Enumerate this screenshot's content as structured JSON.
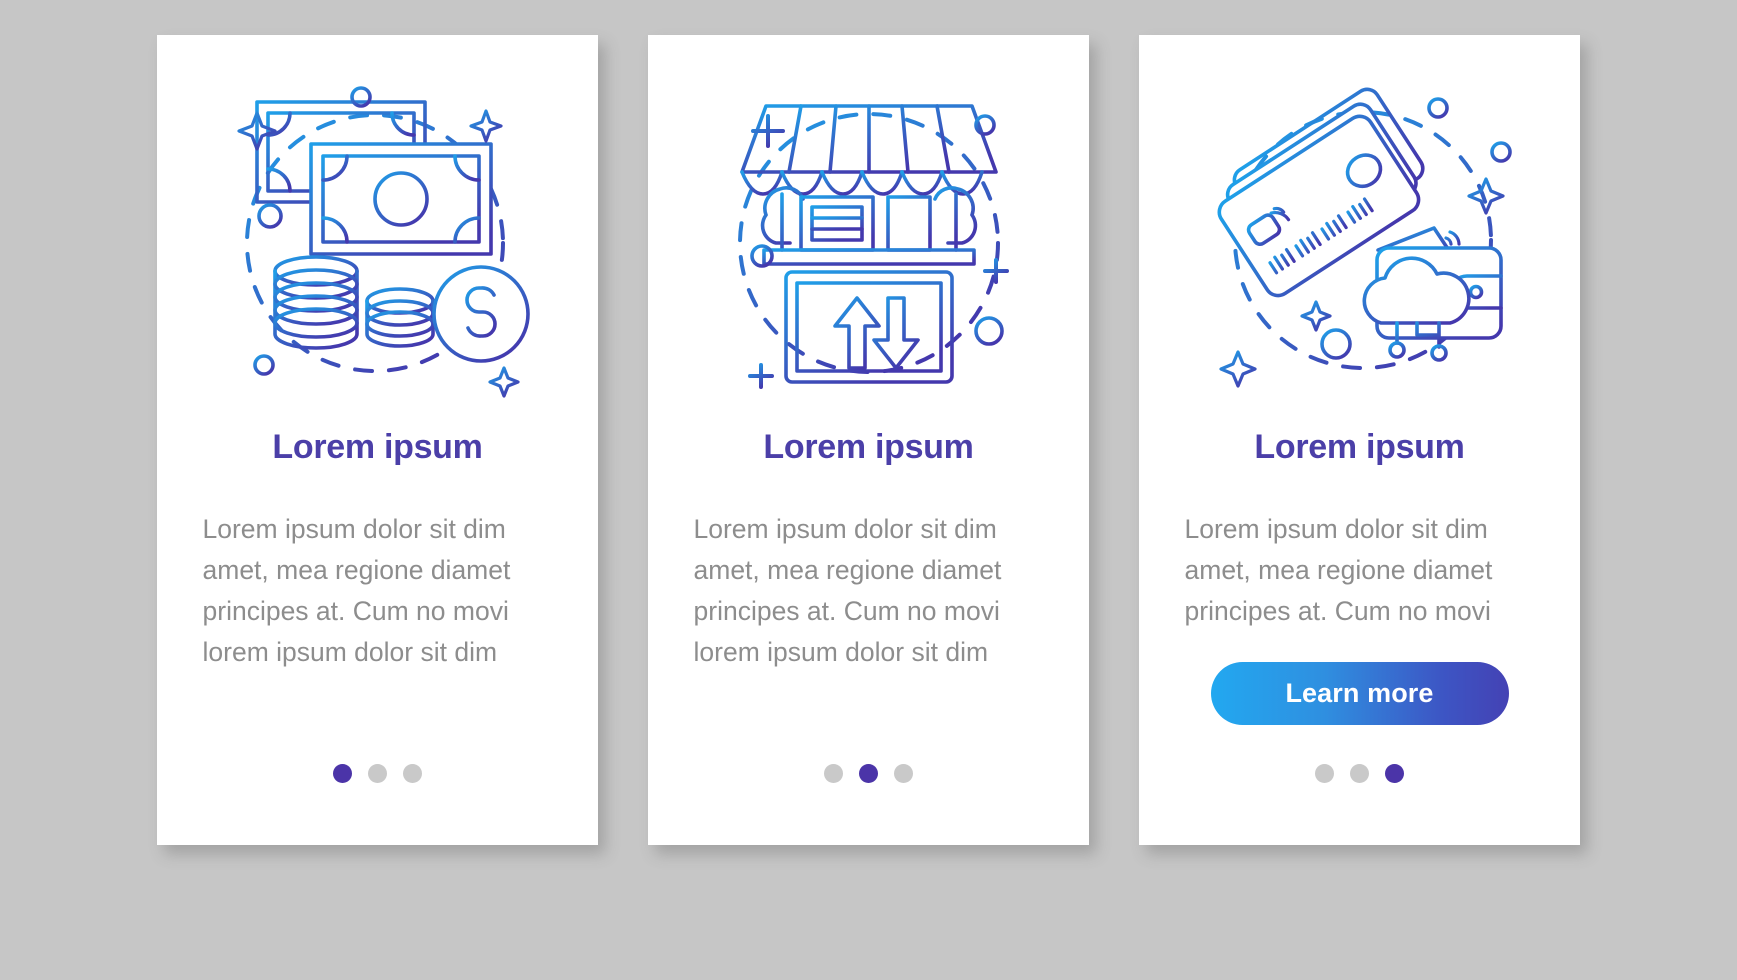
{
  "page": {
    "background_color": "#c6c6c6",
    "card_background": "#ffffff",
    "title_color": "#4b3fa8",
    "body_color": "#8d8d8d",
    "dot_active_color": "#4b34a8",
    "dot_inactive_color": "#c9c9c9",
    "illustration_gradient_start": "#1f9fe8",
    "illustration_gradient_end": "#4438ad"
  },
  "screens": [
    {
      "illustration": "money-cash-coins-illustration",
      "title": "Lorem ipsum",
      "body": "Lorem ipsum dolor sit dim amet, mea regione diamet principes at. Cum no movi lorem ipsum dolor sit dim",
      "has_button": false,
      "button_label": "",
      "dots": [
        {
          "active": true
        },
        {
          "active": false
        },
        {
          "active": false
        }
      ]
    },
    {
      "illustration": "storefront-mobile-transfer-illustration",
      "title": "Lorem ipsum",
      "body": "Lorem ipsum dolor sit dim amet, mea regione diamet principes at. Cum no movi lorem ipsum dolor sit dim",
      "has_button": false,
      "button_label": "",
      "dots": [
        {
          "active": false
        },
        {
          "active": true
        },
        {
          "active": false
        }
      ]
    },
    {
      "illustration": "credit-cards-wallet-cloud-illustration",
      "title": "Lorem ipsum",
      "body": "Lorem ipsum dolor sit dim amet, mea regione diamet principes at. Cum no movi",
      "has_button": true,
      "button_label": "Learn more",
      "dots": [
        {
          "active": false
        },
        {
          "active": false
        },
        {
          "active": true
        }
      ]
    }
  ]
}
